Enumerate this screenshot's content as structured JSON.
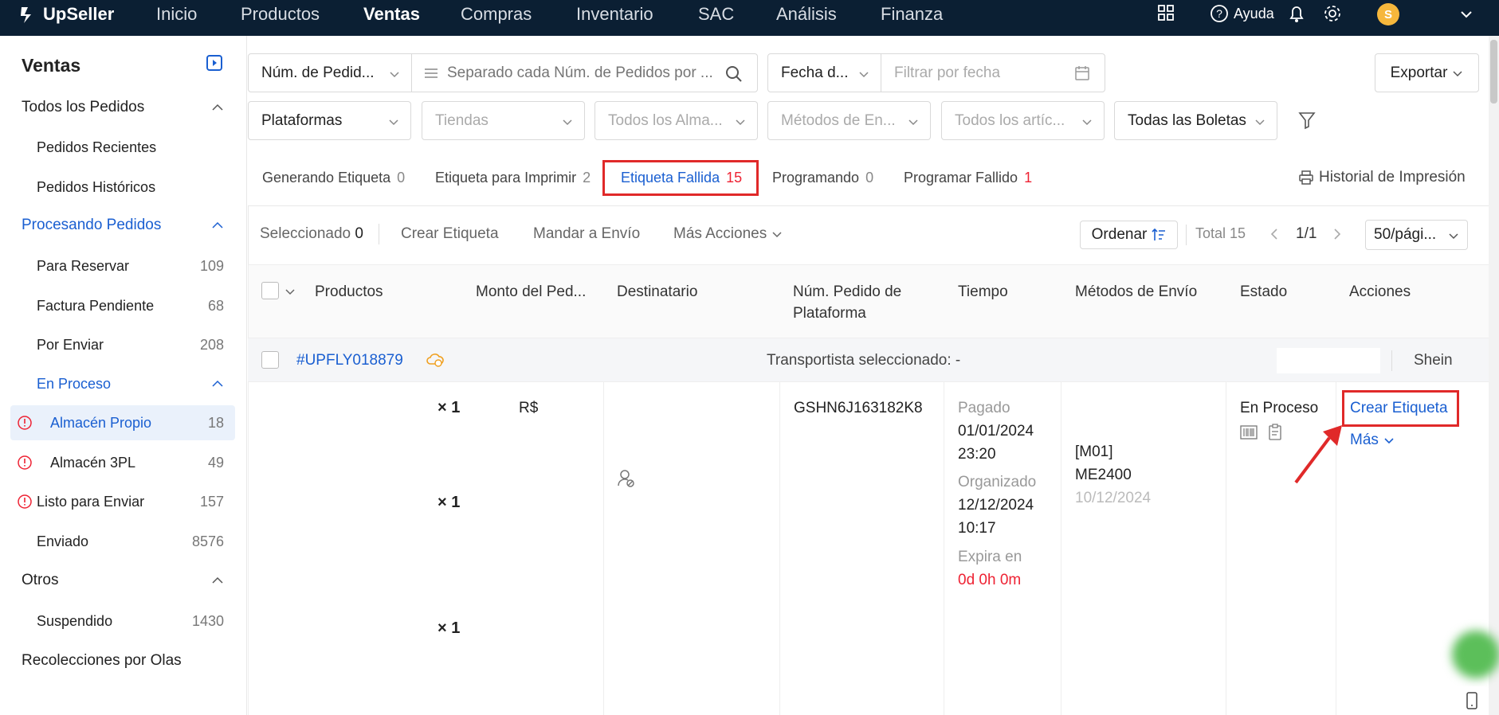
{
  "topnav": {
    "logo": "UpSeller",
    "items": [
      "Inicio",
      "Productos",
      "Ventas",
      "Compras",
      "Inventario",
      "SAC",
      "Análisis",
      "Finanza"
    ],
    "active": "Ventas",
    "help": "Ayuda",
    "avatar_letter": "S"
  },
  "sidebar": {
    "title": "Ventas",
    "items": [
      {
        "label": "Todos los Pedidos",
        "count": "",
        "type": "group"
      },
      {
        "label": "Pedidos Recientes",
        "count": "",
        "type": "sub"
      },
      {
        "label": "Pedidos Históricos",
        "count": "",
        "type": "sub"
      },
      {
        "label": "Procesando Pedidos",
        "count": "",
        "type": "group-active"
      },
      {
        "label": "Para Reservar",
        "count": "109",
        "type": "sub"
      },
      {
        "label": "Factura Pendiente",
        "count": "68",
        "type": "sub"
      },
      {
        "label": "Por Enviar",
        "count": "208",
        "type": "sub"
      },
      {
        "label": "En Proceso",
        "count": "",
        "type": "sub-group"
      },
      {
        "label": "Almacén Propio",
        "count": "18",
        "type": "selected"
      },
      {
        "label": "Almacén 3PL",
        "count": "49",
        "type": "warn"
      },
      {
        "label": "Listo para Enviar",
        "count": "157",
        "type": "warn"
      },
      {
        "label": "Enviado",
        "count": "8576",
        "type": "sub"
      },
      {
        "label": "Otros",
        "count": "",
        "type": "group"
      },
      {
        "label": "Suspendido",
        "count": "1430",
        "type": "sub"
      },
      {
        "label": "Recolecciones por Olas",
        "count": "",
        "type": "group-plain"
      }
    ]
  },
  "filters": {
    "order_num": "Núm. de Pedid...",
    "search_placeholder": "Separado cada Núm. de Pedidos por ...",
    "date_type": "Fecha d...",
    "date_placeholder": "Filtrar por fecha",
    "export": "Exportar",
    "platforms": "Plataformas",
    "stores": "Tiendas",
    "warehouses": "Todos los Alma...",
    "shipping": "Métodos de En...",
    "items": "Todos los artíc...",
    "invoices": "Todas las Boletas"
  },
  "tabs": [
    {
      "label": "Generando Etiqueta",
      "count": "0"
    },
    {
      "label": "Etiqueta para Imprimir",
      "count": "2"
    },
    {
      "label": "Etiqueta Fallida",
      "count": "15"
    },
    {
      "label": "Programando",
      "count": "0"
    },
    {
      "label": "Programar Fallido",
      "count": "1"
    }
  ],
  "print_history": "Historial de Impresión",
  "toolbar": {
    "selected_label": "Seleccionado",
    "selected_count": "0",
    "create_label": "Crear Etiqueta",
    "send": "Mandar a Envío",
    "more": "Más Acciones",
    "sort": "Ordenar",
    "total": "Total 15",
    "page": "1/1",
    "per_page": "50/pági..."
  },
  "columns": [
    "Productos",
    "Monto del Ped...",
    "Destinatario",
    "Núm. Pedido de Plataforma",
    "Tiempo",
    "Métodos de Envío",
    "Estado",
    "Acciones"
  ],
  "order": {
    "id": "#UPFLY018879",
    "carrier": "Transportista seleccionado: -",
    "platform": "Shein",
    "qty": [
      "× 1",
      "× 1",
      "× 1"
    ],
    "amount": "R$",
    "platform_order": "GSHN6J163182K8",
    "paid_label": "Pagado",
    "paid_date": "01/01/2024",
    "paid_time": "23:20",
    "org_label": "Organizado",
    "org_date": "12/12/2024",
    "org_time": "10:17",
    "expire_label": "Expira en",
    "expire_value": "0d 0h 0m",
    "ship_code": "[M01]",
    "ship_method": "ME2400",
    "ship_date": "10/12/2024",
    "status": "En Proceso",
    "action_create": "Crear Etiqueta",
    "action_more": "Más"
  },
  "colors": {
    "accent": "#1a5fd1",
    "nav": "#0b1f33",
    "danger": "#e02929"
  }
}
